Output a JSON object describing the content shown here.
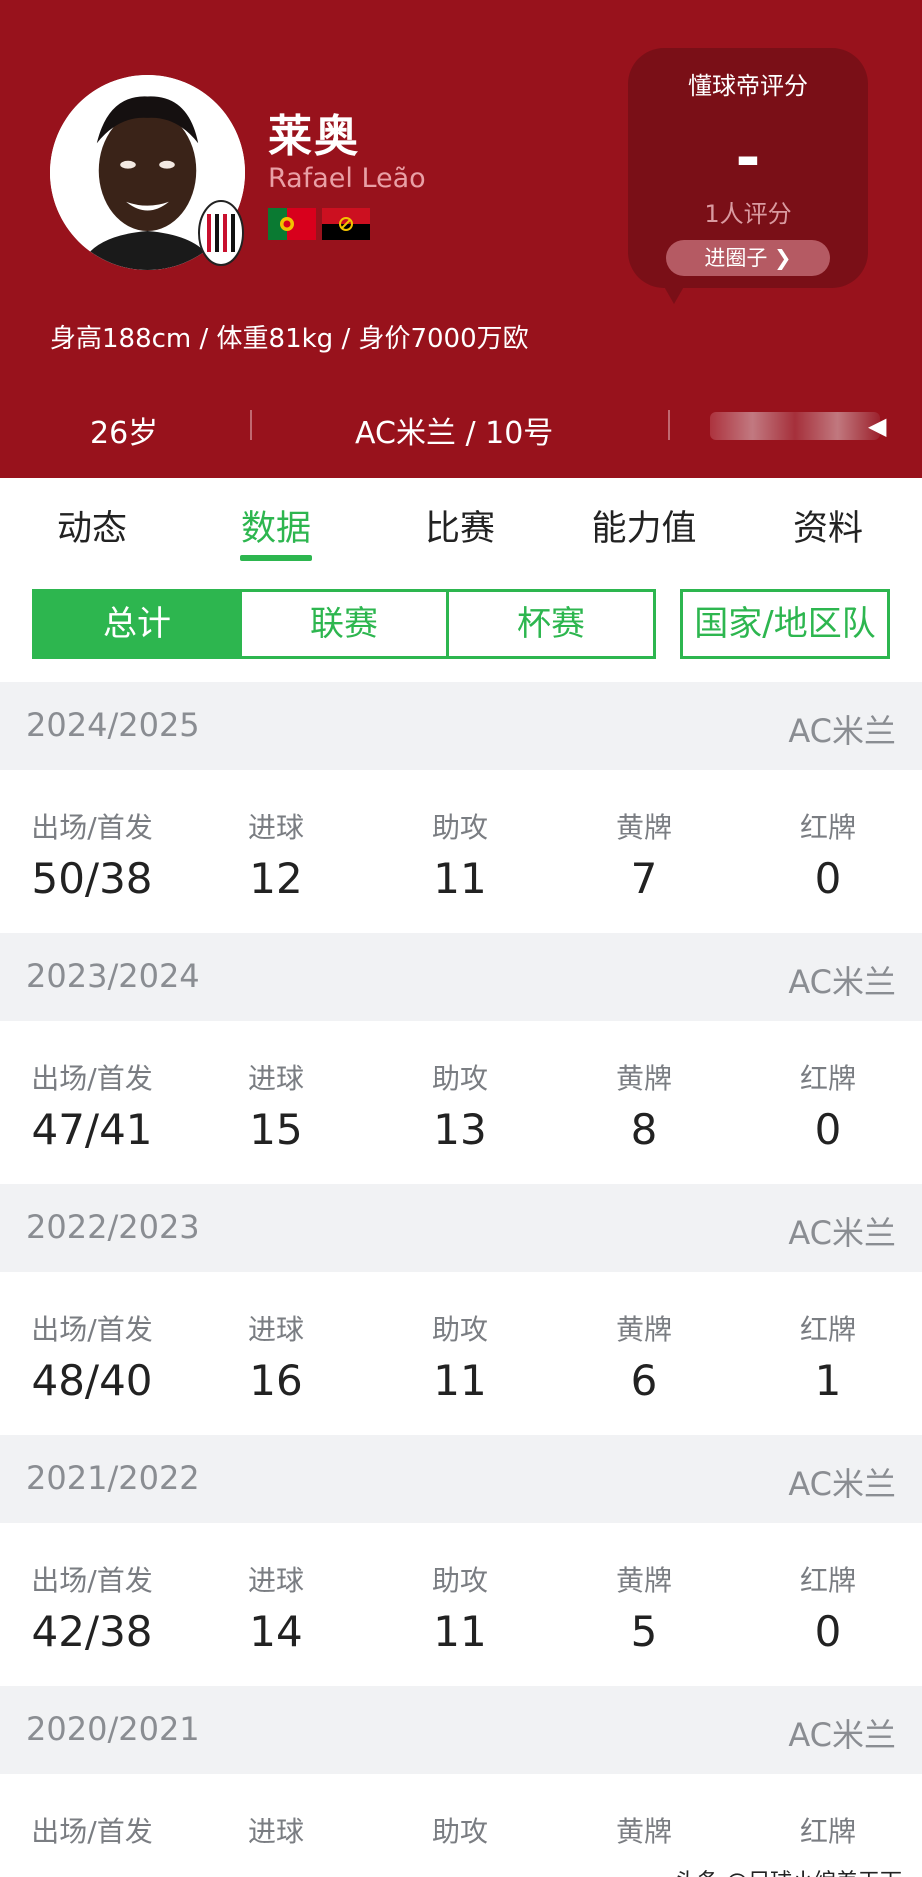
{
  "player": {
    "name_cn": "莱奥",
    "name_latin": "Rafael Leão",
    "bio": "身高188cm / 体重81kg / 身价7000万欧",
    "age": "26岁",
    "club_number": "AC米兰 / 10号"
  },
  "rating": {
    "title": "懂球帝评分",
    "value": "-",
    "count": "1人评分",
    "button_label": "进圈子"
  },
  "tabs": [
    {
      "label": "动态",
      "active": false
    },
    {
      "label": "数据",
      "active": true
    },
    {
      "label": "比赛",
      "active": false
    },
    {
      "label": "能力值",
      "active": false
    },
    {
      "label": "资料",
      "active": false
    }
  ],
  "filters": [
    {
      "label": "总计",
      "active": true
    },
    {
      "label": "联赛",
      "active": false
    },
    {
      "label": "杯赛",
      "active": false
    },
    {
      "label": "国家/地区队",
      "active": false
    }
  ],
  "stat_labels": [
    "出场/首发",
    "进球",
    "助攻",
    "黄牌",
    "红牌"
  ],
  "seasons": [
    {
      "year": "2024/2025",
      "club": "AC米兰",
      "values": [
        "50/38",
        "12",
        "11",
        "7",
        "0"
      ]
    },
    {
      "year": "2023/2024",
      "club": "AC米兰",
      "values": [
        "47/41",
        "15",
        "13",
        "8",
        "0"
      ]
    },
    {
      "year": "2022/2023",
      "club": "AC米兰",
      "values": [
        "48/40",
        "16",
        "11",
        "6",
        "1"
      ]
    },
    {
      "year": "2021/2022",
      "club": "AC米兰",
      "values": [
        "42/38",
        "14",
        "11",
        "5",
        "0"
      ]
    },
    {
      "year": "2020/2021",
      "club": "AC米兰",
      "values": [
        "",
        "",
        "",
        "",
        ""
      ]
    }
  ],
  "watermark": "头条 @足球小编差天下",
  "colors": {
    "header_bg": "#98121c",
    "accent_green": "#2db64f",
    "season_header_bg": "#f1f2f4"
  },
  "icons": {
    "flag_1": "portugal-flag-icon",
    "flag_2": "angola-flag-icon",
    "club_badge": "ac-milan-badge-icon",
    "more": "chevron-right-icon"
  }
}
